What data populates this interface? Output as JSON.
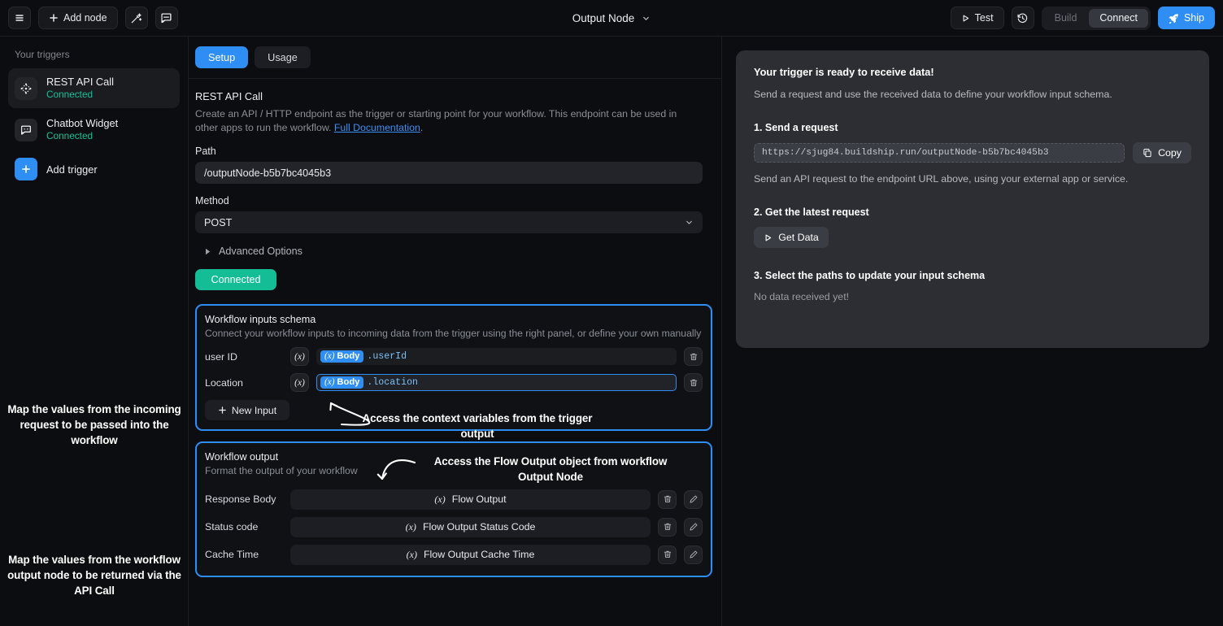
{
  "topbar": {
    "menu_icon": "hamburger-menu-icon",
    "add_node_label": "Add node",
    "add_node_icon": "plus-icon",
    "magic_icon": "magic-wand-icon",
    "chat_icon": "chat-bubble-icon",
    "node_title": "Output Node",
    "node_title_caret": "chevron-down-icon",
    "test_label": "Test",
    "test_icon": "play-icon",
    "history_icon": "history-clock-icon",
    "build_label": "Build",
    "connect_label": "Connect",
    "ship_label": "Ship",
    "ship_icon": "rocket-icon",
    "accent_blue": "#2f8ef4"
  },
  "sidebar": {
    "heading": "Your triggers",
    "triggers": [
      {
        "name": "REST API Call",
        "status": "Connected",
        "icon": "api-node-icon",
        "selected": true
      },
      {
        "name": "Chatbot Widget",
        "status": "Connected",
        "icon": "chatbot-icon",
        "selected": false
      }
    ],
    "add_trigger_label": "Add trigger",
    "add_trigger_icon": "plus-icon",
    "status_color": "#13c29a"
  },
  "annotations": {
    "inputs": "Map the values from the incoming request to be passed into the workflow",
    "output": "Map the values from the workflow output node to be returned via the API Call",
    "context_vars": "Access the context variables from the trigger output",
    "flow_output": "Access the Flow Output object from workflow Output Node"
  },
  "center": {
    "tabs": [
      {
        "label": "Setup",
        "active": true
      },
      {
        "label": "Usage",
        "active": false
      }
    ],
    "section_title": "REST API Call",
    "section_desc_1": "Create an API / HTTP endpoint as the trigger or starting point for your workflow. This endpoint can be used in other apps to run the workflow. ",
    "section_link": "Full Documentation",
    "section_desc_2": ".",
    "path_label": "Path",
    "path_value": "/outputNode-b5b7bc4045b3",
    "method_label": "Method",
    "method_value": "POST",
    "method_caret": "chevron-down-icon",
    "advanced_label": "Advanced Options",
    "advanced_caret": "triangle-right-icon",
    "connected_badge": "Connected",
    "connected_color": "#15bd96"
  },
  "inputs_card": {
    "title": "Workflow inputs schema",
    "desc": "Connect your workflow inputs to incoming data from the trigger using the right panel, or define your own manually",
    "rows": [
      {
        "label": "user ID",
        "x_button": "(x)",
        "chip_prefix": "(x)",
        "chip_label": "Body",
        "path": ".userId",
        "focused": false,
        "delete_icon": "trash-icon"
      },
      {
        "label": "Location",
        "x_button": "(x)",
        "chip_prefix": "(x)",
        "chip_label": "Body",
        "path": ".location",
        "focused": true,
        "delete_icon": "trash-icon"
      }
    ],
    "new_input_label": "New Input",
    "new_input_icon": "plus-icon"
  },
  "output_card": {
    "title": "Workflow output",
    "desc": "Format the output of your workflow",
    "rows": [
      {
        "label": "Response Body",
        "x_prefix": "(x)",
        "value": "Flow Output",
        "delete_icon": "trash-icon",
        "edit_icon": "pencil-icon"
      },
      {
        "label": "Status code",
        "x_prefix": "(x)",
        "value": "Flow Output Status Code",
        "delete_icon": "trash-icon",
        "edit_icon": "pencil-icon"
      },
      {
        "label": "Cache Time",
        "x_prefix": "(x)",
        "value": "Flow Output Cache Time",
        "delete_icon": "trash-icon",
        "edit_icon": "pencil-icon"
      }
    ]
  },
  "right_panel": {
    "title": "Your trigger is ready to receive data!",
    "subtitle": "Send a request and use the received data to define your workflow input schema.",
    "step1_label": "1. Send a request",
    "endpoint_url": "https://sjug84.buildship.run/outputNode-b5b7bc4045b3",
    "copy_label": "Copy",
    "copy_icon": "copy-icon",
    "step1_note": "Send an API request to the endpoint URL above, using your external app or service.",
    "step2_label": "2. Get the latest request",
    "get_data_label": "Get Data",
    "get_data_icon": "play-icon",
    "step3_label": "3. Select the paths to update your input schema",
    "no_data_label": "No data received yet!"
  }
}
